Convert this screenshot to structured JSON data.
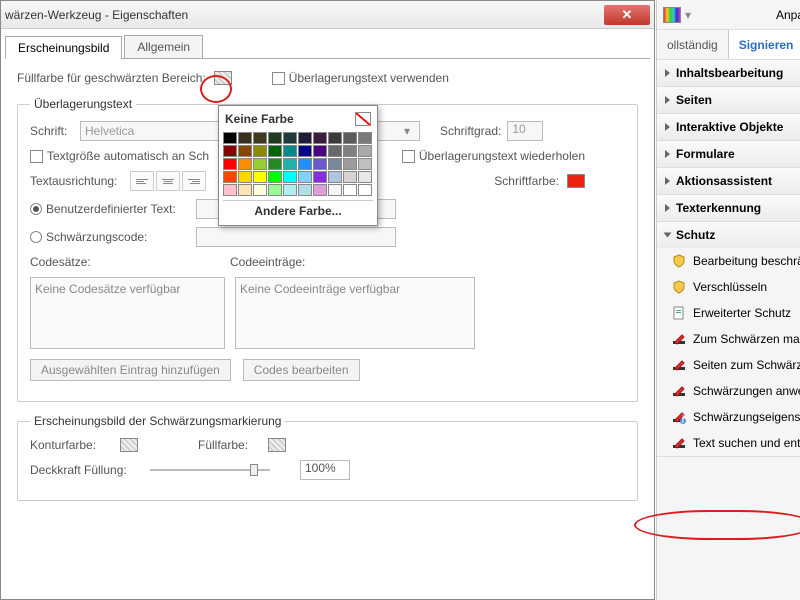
{
  "dialog": {
    "title": "wärzen-Werkzeug - Eigenschaften",
    "tabs": [
      "Erscheinungsbild",
      "Allgemein"
    ],
    "fillLabel": "Füllfarbe für geschwärzten Bereich:",
    "useOverlay": "Überlagerungstext verwenden",
    "overlayGroup": "Überlagerungstext",
    "fontLabel": "Schrift:",
    "fontValue": "Helvetica",
    "fontSizeLabel": "Schriftgrad:",
    "fontSizeValue": "10",
    "autoSize": "Textgröße automatisch an Sch",
    "repeatOverlay": "Überlagerungstext wiederholen",
    "alignLabel": "Textausrichtung:",
    "fontColorLabel": "Schriftfarbe:",
    "customTextLabel": "Benutzerdefinierter Text:",
    "redactCodeLabel": "Schwärzungscode:",
    "codeSetsLabel": "Codesätze:",
    "codeEntriesLabel": "Codeeinträge:",
    "noCodeSets": "Keine Codesätze verfügbar",
    "noCodeEntries": "Keine Codeeinträge verfügbar",
    "addSelected": "Ausgewählten Eintrag hinzufügen",
    "editCodes": "Codes bearbeiten",
    "markGroup": "Erscheinungsbild der Schwärzungsmarkierung",
    "outlineLabel": "Konturfarbe:",
    "markFillLabel": "Füllfarbe:",
    "opacityLabel": "Deckkraft Füllung:",
    "opacityValue": "100%"
  },
  "picker": {
    "noColor": "Keine Farbe",
    "other": "Andere Farbe...",
    "colors": [
      "#000000",
      "#3b2e1e",
      "#3b3b1e",
      "#1e3b1e",
      "#1e3b3b",
      "#1e1e3b",
      "#3b1e3b",
      "#3b3b3b",
      "#5a5a5a",
      "#7a7a7a",
      "#8b0000",
      "#8b4500",
      "#8b8b00",
      "#006400",
      "#008b8b",
      "#00008b",
      "#4b0082",
      "#696969",
      "#808080",
      "#a9a9a9",
      "#ff0000",
      "#ff8c00",
      "#9acd32",
      "#228b22",
      "#20b2aa",
      "#1e90ff",
      "#6a5acd",
      "#778899",
      "#9c9c9c",
      "#c0c0c0",
      "#ff4500",
      "#ffd700",
      "#ffff00",
      "#00ff00",
      "#00ffff",
      "#87cefa",
      "#8a2be2",
      "#b0c4de",
      "#d3d3d3",
      "#e8e8e8",
      "#ffc0cb",
      "#ffe4b5",
      "#ffffe0",
      "#98fb98",
      "#afeeee",
      "#b0e0e6",
      "#dda0dd",
      "#f5f5f5",
      "#ffffff",
      "#ffffff"
    ]
  },
  "side": {
    "customize": "Anpas",
    "full": "ollständig",
    "sign": "Signieren",
    "sections": [
      "Inhaltsbearbeitung",
      "Seiten",
      "Interaktive Objekte",
      "Formulare",
      "Aktionsassistent",
      "Texterkennung",
      "Schutz"
    ],
    "schutzItems": [
      {
        "icon": "shield",
        "label": "Bearbeitung beschränken"
      },
      {
        "icon": "shield",
        "label": "Verschlüsseln"
      },
      {
        "icon": "doc",
        "label": "Erweiterter Schutz"
      },
      {
        "icon": "redact",
        "label": "Zum Schwärzen markiere"
      },
      {
        "icon": "redact",
        "label": "Seiten zum Schwärzen m"
      },
      {
        "icon": "redact",
        "label": "Schwärzungen anwenden"
      },
      {
        "icon": "redact-info",
        "label": "Schwärzungseigenschafte"
      },
      {
        "icon": "redact",
        "label": "Text suchen und entferne"
      }
    ]
  }
}
